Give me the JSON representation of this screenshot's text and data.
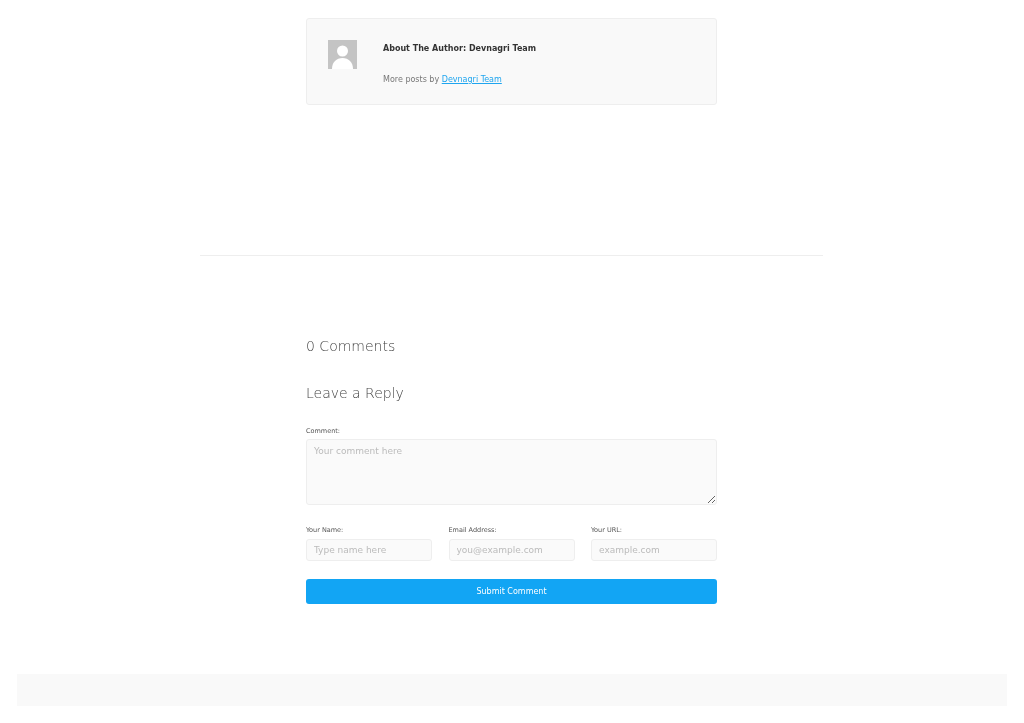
{
  "author_box": {
    "title": "About The Author: Devnagri Team",
    "more_posts_text": "More posts by",
    "more_posts_link": "Devnagri Team"
  },
  "comments_heading": "0 Comments",
  "reply_heading": "Leave a Reply",
  "comment_field": {
    "label": "Comment:",
    "placeholder": "Your comment here"
  },
  "fields": [
    {
      "label": "Your Name:",
      "placeholder": "Type name here"
    },
    {
      "label": "Email Address:",
      "placeholder": "you@example.com"
    },
    {
      "label": "Your URL:",
      "placeholder": "example.com"
    }
  ],
  "submit_button": "Submit Comment"
}
